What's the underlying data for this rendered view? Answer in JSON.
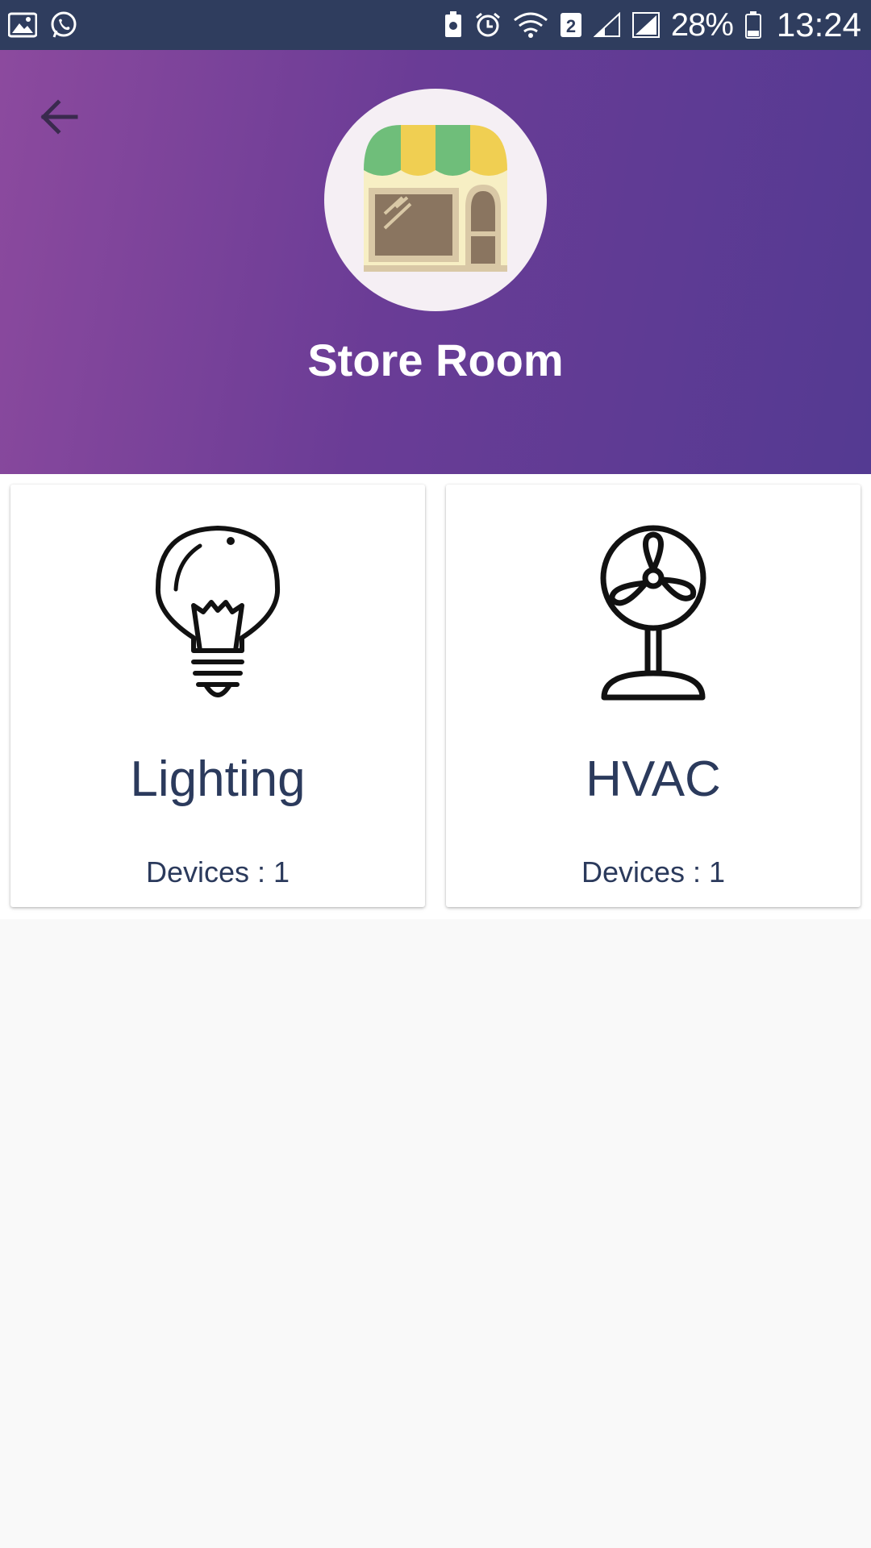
{
  "status_bar": {
    "left_icons": [
      "gallery-icon",
      "whatsapp-icon"
    ],
    "right_icons": [
      "battery-saver-icon",
      "alarm-icon",
      "wifi-icon",
      "sim-2-icon",
      "signal-icon",
      "signal-icon"
    ],
    "sim_label": "2",
    "battery": "28%",
    "time": "13:24"
  },
  "header": {
    "back_icon": "arrow-left-icon",
    "avatar_icon": "storefront-icon",
    "title": "Store Room",
    "gradient": [
      "#8c4a9e",
      "#543a92"
    ]
  },
  "categories": [
    {
      "icon": "lightbulb-icon",
      "title": "Lighting",
      "devices": "Devices : 1"
    },
    {
      "icon": "fan-icon",
      "title": "HVAC",
      "devices": "Devices : 1"
    }
  ],
  "colors": {
    "status_bar": "#2f3d5e",
    "text_primary": "#2b3a5c",
    "background": "#f9f9f9"
  }
}
